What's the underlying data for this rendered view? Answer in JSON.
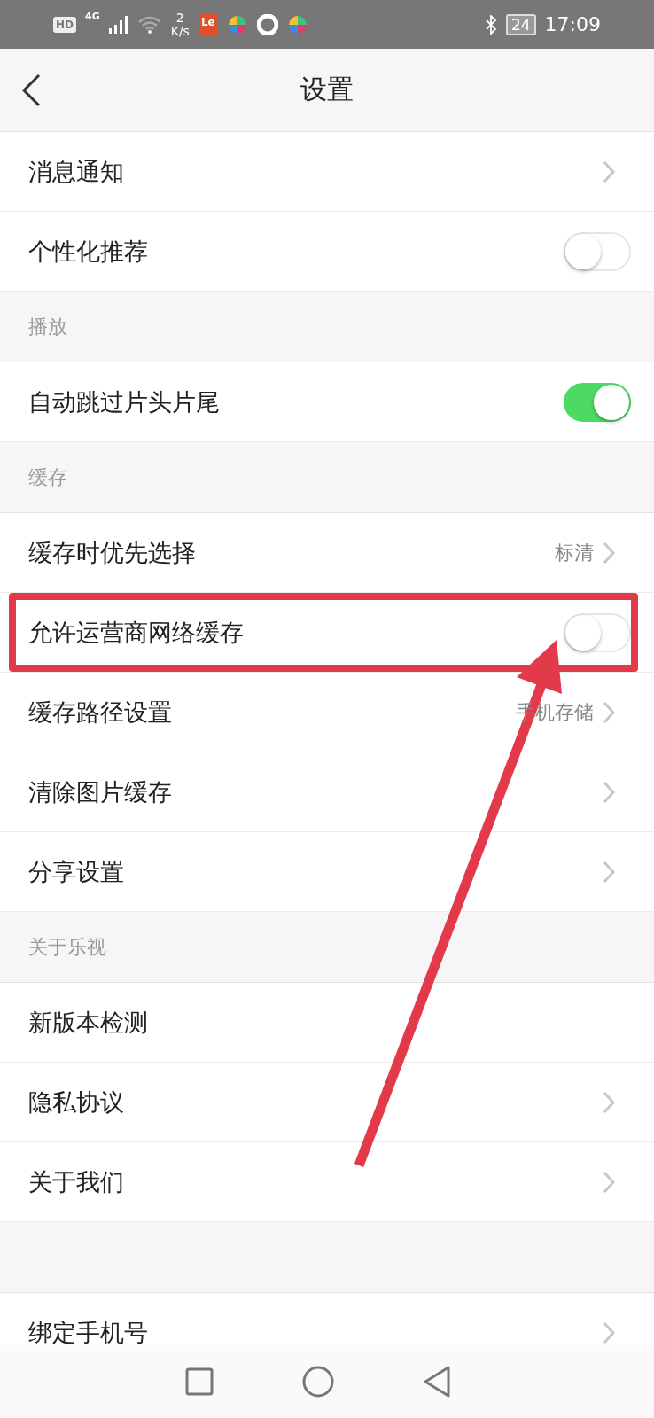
{
  "status_bar": {
    "hd": "HD",
    "network": "4G",
    "speed": "2",
    "speed_unit": "K/s",
    "app_label": "Le",
    "battery": "24",
    "time": "17:09"
  },
  "header": {
    "title": "设置"
  },
  "sections": [
    {
      "items": [
        {
          "label": "消息通知",
          "kind": "chevron",
          "highlighted": false
        },
        {
          "label": "个性化推荐",
          "kind": "toggle",
          "on": false,
          "highlighted": false
        }
      ]
    },
    {
      "header": "播放",
      "items": [
        {
          "label": "自动跳过片头片尾",
          "kind": "toggle",
          "on": true,
          "highlighted": false
        }
      ]
    },
    {
      "header": "缓存",
      "items": [
        {
          "label": "缓存时优先选择",
          "kind": "chevron",
          "value": "标清",
          "highlighted": false
        },
        {
          "label": "允许运营商网络缓存",
          "kind": "toggle",
          "on": false,
          "highlighted": true
        },
        {
          "label": "缓存路径设置",
          "kind": "chevron",
          "value": "手机存储",
          "highlighted": false
        },
        {
          "label": "清除图片缓存",
          "kind": "chevron",
          "highlighted": false
        },
        {
          "label": "分享设置",
          "kind": "chevron",
          "highlighted": false
        }
      ]
    },
    {
      "header": "关于乐视",
      "items": [
        {
          "label": "新版本检测",
          "kind": "plain",
          "highlighted": false
        },
        {
          "label": "隐私协议",
          "kind": "chevron",
          "highlighted": false
        },
        {
          "label": "关于我们",
          "kind": "chevron",
          "highlighted": false
        }
      ]
    },
    {
      "items": [
        {
          "label": "绑定手机号",
          "kind": "chevron",
          "highlighted": false
        }
      ]
    }
  ]
}
